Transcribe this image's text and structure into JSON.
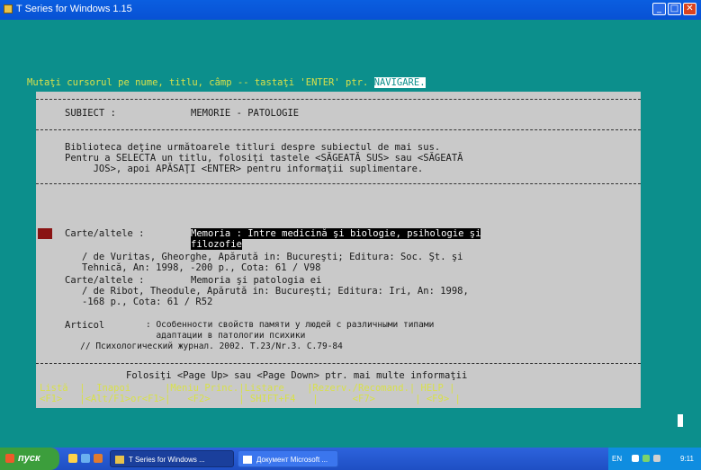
{
  "window": {
    "title": "T Series for Windows 1.15",
    "min": "_",
    "max": "□",
    "close": "✕"
  },
  "instruction": {
    "text": "Mutaţi cursorul pe nume, titlu, câmp -- tastaţi 'ENTER' ptr. ",
    "highlight": "NAVIGARE."
  },
  "subject": {
    "label": "SUBIECT :",
    "value": "MEMORIE - PATOLOGIE"
  },
  "intro": [
    "Biblioteca deţine următoarele titluri despre subiectul de mai sus.",
    "Pentru a SELECTA un titlu, folosiţi tastele <SĂGEATĂ SUS> sau <SĂGEATĂ",
    "     JOS>, apoi APĂSAŢI <ENTER> pentru informaţii suplimentare."
  ],
  "records": [
    {
      "type": "Carte/altele : ",
      "title_l1": "Memoria : Intre medicină şi biologie, psihologie şi",
      "title_l2": "filozofie",
      "d1": "   / de Vuritas, Gheorghe, Apărută in: Bucureşti; Editura: Soc. Şt. şi",
      "d2": "   Tehnică, An: 1998, -200 p., Cota: 61 / V98"
    },
    {
      "type": "Carte/altele : ",
      "title": "Memoria şi patologia ei",
      "d1": "   / de Ribot, Theodule, Apărută in: Bucureşti; Editura: Iri, An: 1998,",
      "d2": "   -168 p., Cota: 61 / R52"
    },
    {
      "type": "Articol      ",
      "t1": ": Особенности свойств памяти у людей с различными типами",
      "t2": "  адаптации в патологии психики",
      "d1": "   // Психологический журнал. 2002. Т.23/Nr.3. С.79-84"
    }
  ],
  "paging": "Folosiţi <Page Up> sau <Page Down> ptr. mai multe informaţii",
  "help": {
    "line1": "Listă  |  Inapoi      |Meniu Princ.|Listare    |Rezerv./Recomand.| HELP |",
    "line2": "<F1>   |<Alt/F1>or<F1>|   <F2>     | SHIFT+F4   |      <F7>       | <F9> |"
  },
  "taskbar": {
    "start": "пуск",
    "tasks": [
      "T Series for Windows ...",
      "Документ Microsoft ..."
    ],
    "lang": "EN",
    "clock": "9:11"
  }
}
